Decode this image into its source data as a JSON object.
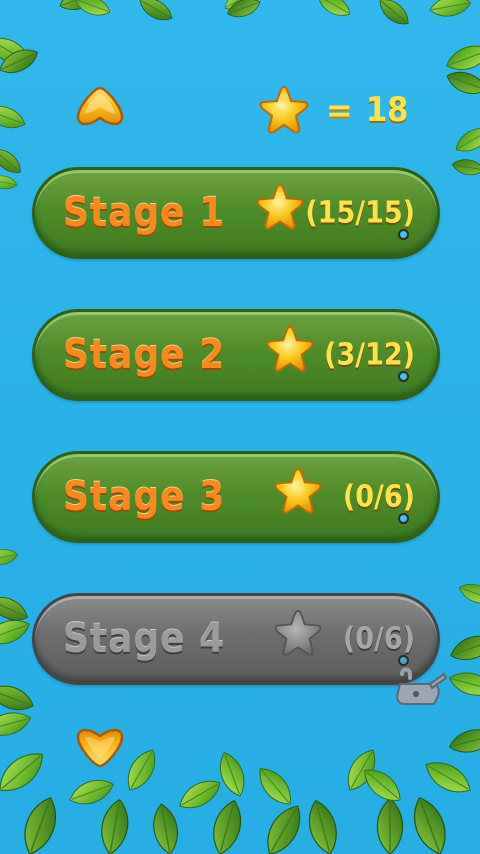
{
  "stars_total": {
    "icon": "star-icon",
    "equals": "=",
    "count": "18"
  },
  "nav": {
    "up_icon": "arrow-up-icon",
    "down_icon": "arrow-down-icon"
  },
  "stages": [
    {
      "label": "Stage 1",
      "score": "(15/15)",
      "locked": false,
      "icon": "star-icon"
    },
    {
      "label": "Stage 2",
      "score": "(3/12)",
      "locked": false,
      "icon": "star-icon"
    },
    {
      "label": "Stage 3",
      "score": "(0/6)",
      "locked": false,
      "icon": "star-icon"
    },
    {
      "label": "Stage 4",
      "score": "(0/6)",
      "locked": true,
      "icon": "star-icon"
    }
  ],
  "colors": {
    "background": "#29b2e8",
    "stage_unlocked": "#4f8c2a",
    "stage_locked": "#6e6e6e",
    "label_orange": "#f7891e",
    "score_yellow": "#fde24a",
    "star_gold": "#fcc61a"
  }
}
